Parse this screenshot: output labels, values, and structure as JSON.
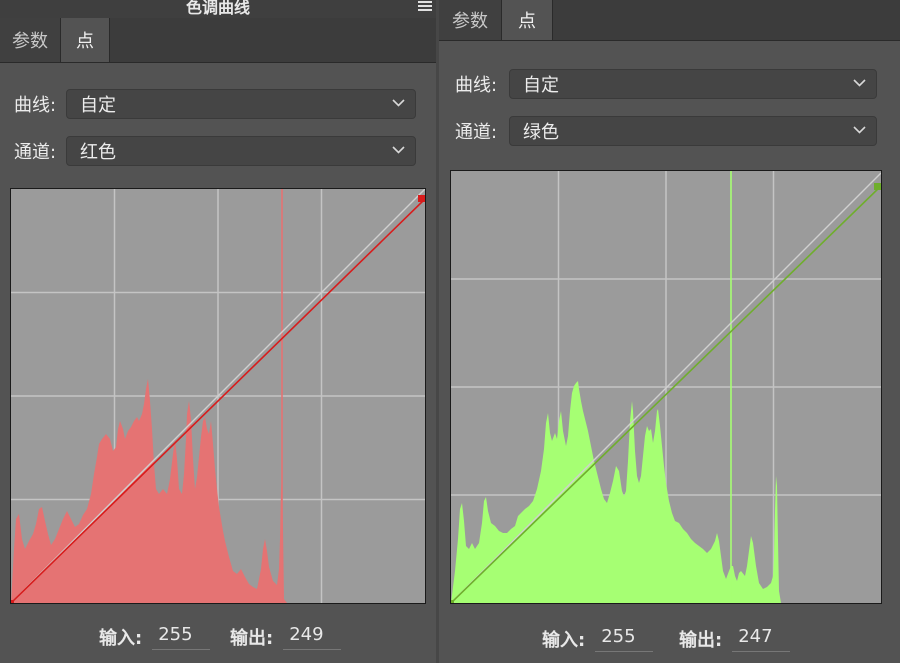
{
  "left_panel": {
    "title": "色调曲线",
    "tabs": [
      {
        "label": "参数",
        "active": false
      },
      {
        "label": "点",
        "active": true
      }
    ],
    "curve_label": "曲线:",
    "curve_value": "自定",
    "channel_label": "通道:",
    "channel_value": "红色",
    "channel_color": "#e06060",
    "histogram_color": "#e57373",
    "curve_line_color": "#d81c1c",
    "input_label": "输入:",
    "input_value": "255",
    "output_label": "输出:",
    "output_value": "249"
  },
  "right_panel": {
    "tabs": [
      {
        "label": "参数",
        "active": false
      },
      {
        "label": "点",
        "active": true
      }
    ],
    "curve_label": "曲线:",
    "curve_value": "自定",
    "channel_label": "通道:",
    "channel_value": "绿色",
    "channel_color": "#a6ff73",
    "histogram_color": "#a6ff73",
    "curve_line_color": "#6fae2c",
    "input_label": "输入:",
    "input_value": "255",
    "output_label": "输出:",
    "output_value": "247"
  }
}
